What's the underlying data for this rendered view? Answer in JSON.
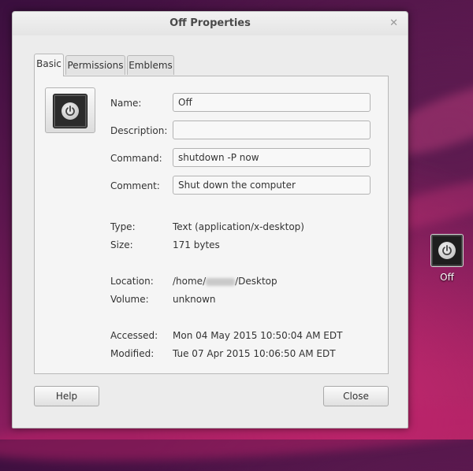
{
  "window": {
    "title": "Off Properties"
  },
  "tabs": [
    {
      "label": "Basic",
      "active": true
    },
    {
      "label": "Permissions",
      "active": false
    },
    {
      "label": "Emblems",
      "active": false
    }
  ],
  "basic": {
    "icon_name": "power-icon",
    "fields": {
      "name": {
        "label": "Name:",
        "value": "Off"
      },
      "description": {
        "label": "Description:",
        "value": ""
      },
      "command": {
        "label": "Command:",
        "value": "shutdown -P now"
      },
      "comment": {
        "label": "Comment:",
        "value": "Shut down the computer"
      }
    },
    "info": {
      "type": {
        "label": "Type:",
        "value": "Text (application/x-desktop)"
      },
      "size": {
        "label": "Size:",
        "value": "171 bytes"
      },
      "location": {
        "label": "Location:",
        "value_prefix": "/home/",
        "value_suffix": "/Desktop"
      },
      "volume": {
        "label": "Volume:",
        "value": "unknown"
      },
      "accessed": {
        "label": "Accessed:",
        "value": "Mon 04 May 2015 10:50:04 AM EDT"
      },
      "modified": {
        "label": "Modified:",
        "value": "Tue 07 Apr 2015 10:06:50 AM EDT"
      }
    }
  },
  "buttons": {
    "help": "Help",
    "close": "Close"
  },
  "desktop": {
    "icon_label": "Off"
  },
  "icons": {
    "close": "✕"
  }
}
